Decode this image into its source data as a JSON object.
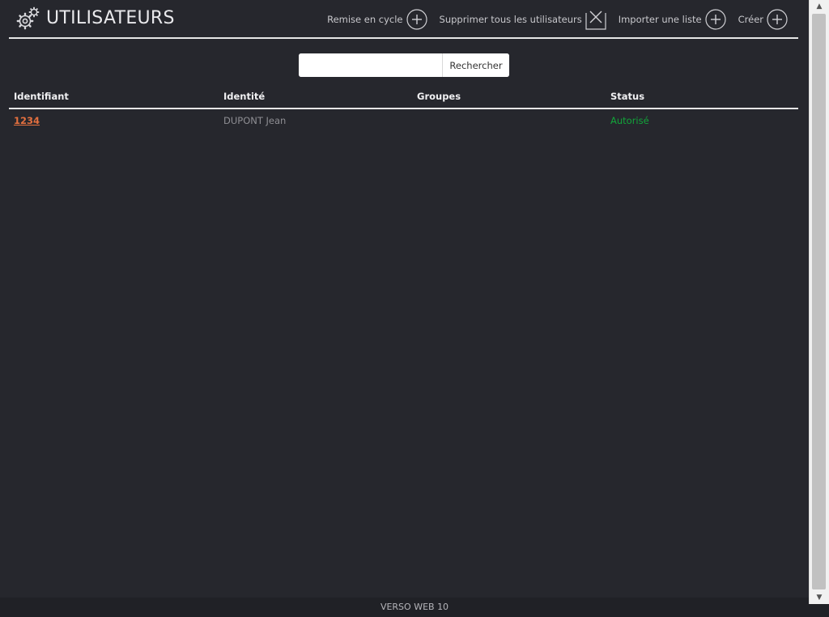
{
  "header": {
    "title": "UTILISATEURS",
    "actions": [
      {
        "label": "Remise en cycle",
        "icon": "circle-plus-icon"
      },
      {
        "label": "Supprimer tous les utilisateurs",
        "icon": "box-x-icon"
      },
      {
        "label": "Importer une liste",
        "icon": "circle-plus-icon"
      },
      {
        "label": "Créer",
        "icon": "circle-plus-icon"
      }
    ]
  },
  "search": {
    "value": "",
    "placeholder": "",
    "button_label": "Rechercher"
  },
  "table": {
    "columns": [
      "Identifiant",
      "Identité",
      "Groupes",
      "Status"
    ],
    "rows": [
      {
        "identifiant": "1234",
        "identite": "DUPONT Jean",
        "groupes": "",
        "status": "Autorisé"
      }
    ]
  },
  "footer": {
    "text": "VERSO WEB 10"
  },
  "colors": {
    "background": "#26272d",
    "link": "#e4703f",
    "status_ok": "#12a53a",
    "header_text": "#e9e9ec"
  }
}
